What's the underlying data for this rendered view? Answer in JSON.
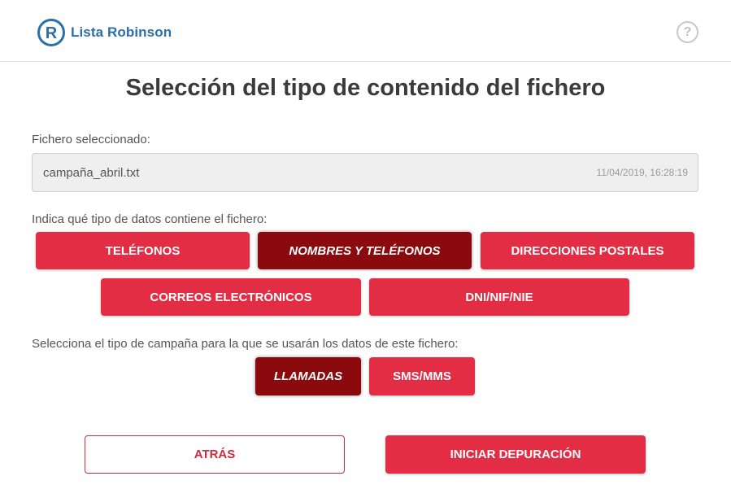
{
  "header": {
    "logo_text": "Lista Robinson",
    "logo_letter": "R",
    "help_symbol": "?"
  },
  "colors": {
    "accent": "#e22d45",
    "selected": "#8a0a0e",
    "brand": "#2b6fa8"
  },
  "main": {
    "title": "Selección del tipo de contenido del fichero",
    "file_label": "Fichero seleccionado:",
    "file_name": "campaña_abril.txt",
    "file_date": "11/04/2019, 16:28:19",
    "data_type_label": "Indica qué tipo de datos contiene el fichero:",
    "data_types": [
      {
        "label": "TELÉFONOS",
        "selected": false
      },
      {
        "label": "NOMBRES Y TELÉFONOS",
        "selected": true
      },
      {
        "label": "DIRECCIONES POSTALES",
        "selected": false
      },
      {
        "label": "CORREOS ELECTRÓNICOS",
        "selected": false
      },
      {
        "label": "DNI/NIF/NIE",
        "selected": false
      }
    ],
    "campaign_label": "Selecciona el tipo de campaña para la que se usarán los datos de este fichero:",
    "campaign_types": [
      {
        "label": "LLAMADAS",
        "selected": true
      },
      {
        "label": "SMS/MMS",
        "selected": false
      }
    ]
  },
  "footer": {
    "back_label": "ATRÁS",
    "start_label": "INICIAR DEPURACIÓN"
  }
}
